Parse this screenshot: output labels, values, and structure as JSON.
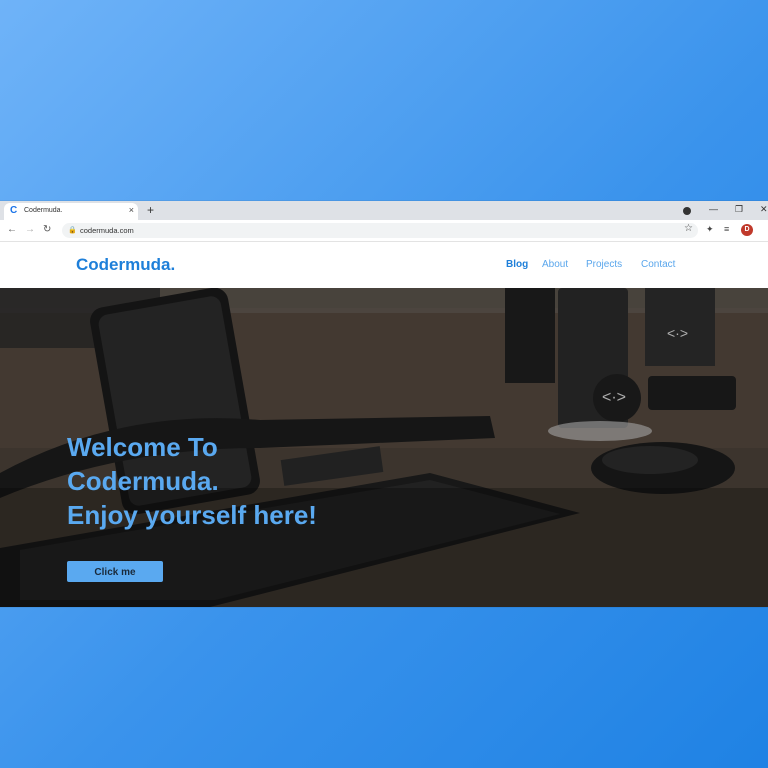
{
  "browser": {
    "tab_title": "Codermuda.",
    "tab_favicon": "C",
    "tab_close": "×",
    "new_tab": "+",
    "url": "codermuda.com",
    "profile_initial": "D",
    "icons": [
      "back-icon",
      "forward-icon",
      "reload-icon",
      "lock-icon",
      "star-icon",
      "extensions-icon",
      "reading-list-icon",
      "minimize-icon",
      "restore-icon",
      "close-icon"
    ]
  },
  "site": {
    "logo": "Codermuda.",
    "nav": [
      "Blog",
      "About",
      "Projects",
      "Contact"
    ],
    "active_nav": "Blog",
    "hero": {
      "line1": "Welcome To",
      "line2": "Codermuda.",
      "line3": "Enjoy yourself here!",
      "button": "Click me"
    }
  },
  "colors": {
    "accent": "#1e7fd9",
    "hero_text": "#5aa9f0",
    "background": "#3a93ec"
  }
}
